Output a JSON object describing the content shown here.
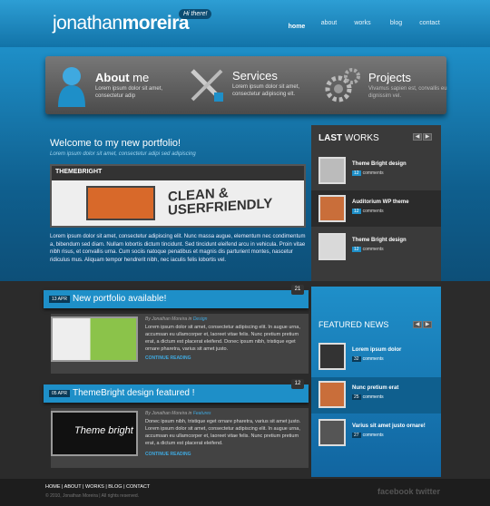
{
  "header": {
    "logo_first": "jonathan",
    "logo_second": "moreira",
    "bubble": "Hi there!",
    "nav": [
      "home",
      "about",
      "works",
      "blog",
      "contact"
    ]
  },
  "services": [
    {
      "title_bold": "About",
      "title_rest": " me",
      "text": "Lorem ipsum dolor sit amet, consectetur adip",
      "icon": "user-icon"
    },
    {
      "title_bold": "Services",
      "title_rest": "",
      "text": "Lorem ipsum dolor sit amet, consectetur adipiscing elt.",
      "icon": "tools-icon"
    },
    {
      "title_bold": "Projects",
      "title_rest": "",
      "text": "Vivamus sapien est, convallis eu dignissim vel.",
      "icon": "gears-icon"
    }
  ],
  "welcome": {
    "title": "Welcome to my new portfolio!",
    "subtitle": "Lorem ipsum dolor sit amet, consectetur adipi sed adipiscing",
    "banner_logo": "THEMEBRIGHT",
    "banner_headline": "CLEAN & USERFRIENDLY",
    "text": "Lorem ipsum dolor sit amet, consectetur adipiscing elit. Nunc massa augue, elementum nec condimentum a, bibendum sed diam. Nullam lobortis dictum tincidunt. Sed tincidunt eleifend arcu in vehicula. Proin vitae nibh risus, et convallis urna. Cum sociis natoque penatibus et magnis dis parturient montes, nascetur ridiculus mus. Aliquam tempor hendrerit nibh, nec iaculis felis lobortis vel."
  },
  "last_works": {
    "title_bold": "LAST",
    "title_rest": " WORKS",
    "items": [
      {
        "title": "Theme Bright design",
        "count": "12",
        "comments": "comments"
      },
      {
        "title": "Auditorium WP theme",
        "count": "12",
        "comments": "comments"
      },
      {
        "title": "Theme Bright design",
        "count": "12",
        "comments": "comments"
      }
    ]
  },
  "featured": {
    "title_bold": "FEATURED",
    "title_rest": " NEWS",
    "items": [
      {
        "title": "Lorem ipsum dolor",
        "count": "32",
        "comments": "comments"
      },
      {
        "title": "Nunc pretium erat",
        "count": "25",
        "comments": "comments"
      },
      {
        "title": "Varius sit amet justo ornare!",
        "count": "27",
        "comments": "comments"
      }
    ]
  },
  "posts": [
    {
      "date": "13 APR",
      "title": "New portfolio available!",
      "count": "21",
      "meta_prefix": "By Jonathan Moreira in ",
      "meta_category": "Design",
      "text": "Lorem ipsum dolor sit amet, consectetur adipiscing elit. In augue urna, accumsan eu ullamcorper et, laoreet vitae felis. Nunc pretium pretium erat, a dictum est placerat eleifend. Donec ipsum nibh, tristique eget ornare pharetra, varius sit amet justo.",
      "more": "CONTINUE READING"
    },
    {
      "date": "05 APR",
      "title": "ThemeBright design featured !",
      "count": "12",
      "meta_prefix": "By Jonathan Moreira in ",
      "meta_category": "Features",
      "text": "Donec ipsum nibh, tristique eget ornare pharetra, varius sit amet justo. Lorem ipsum dolor sit amet, consectetur adipiscing elit. In augue urna, accumsan eu ullamcorper et, laoreet vitae felis. Nunc pretium pretium erat, a dictum est placerat eleifend.",
      "more": "CONTINUE READING",
      "thumb_text": "Theme bright"
    }
  ],
  "footer": {
    "nav": "HOME | ABOUT | WORKS | BLOG | CONTACT",
    "copyright": "© 2010, Jonathan Moreira | All rights reserved.",
    "social": "facebook twitter"
  },
  "colors": {
    "accent": "#1e8fc8",
    "dark": "#2b2b2b"
  }
}
